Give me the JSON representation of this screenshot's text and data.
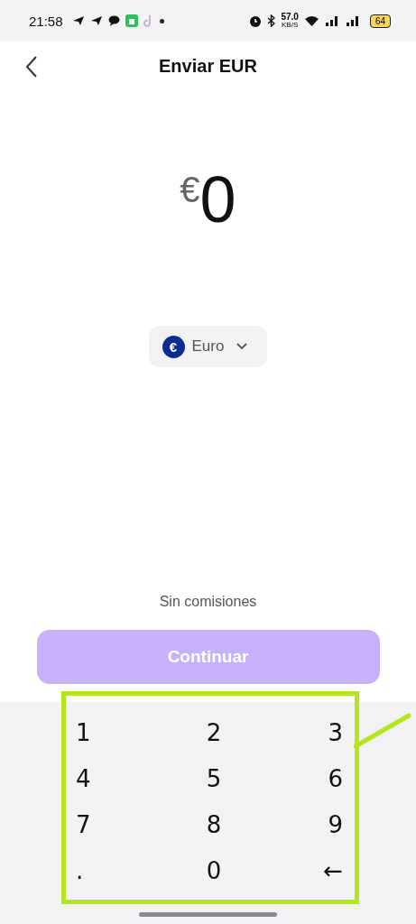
{
  "status_bar": {
    "time": "21:58",
    "speed": "57.0",
    "speed_unit": "KB/S",
    "battery": "64"
  },
  "header": {
    "title": "Enviar EUR"
  },
  "amount": {
    "symbol": "€",
    "value": "0"
  },
  "currency": {
    "symbol": "€",
    "label": "Euro"
  },
  "fee_note": "Sin comisiones",
  "continue_button": {
    "label": "Continuar",
    "disabled": true
  },
  "keypad": {
    "keys": [
      {
        "label": "1"
      },
      {
        "label": "2"
      },
      {
        "label": "3"
      },
      {
        "label": "4"
      },
      {
        "label": "5"
      },
      {
        "label": "6"
      },
      {
        "label": "7"
      },
      {
        "label": "8"
      },
      {
        "label": "9"
      },
      {
        "label": "."
      },
      {
        "label": "0"
      },
      {
        "label": "←"
      }
    ],
    "highlighted": true
  }
}
